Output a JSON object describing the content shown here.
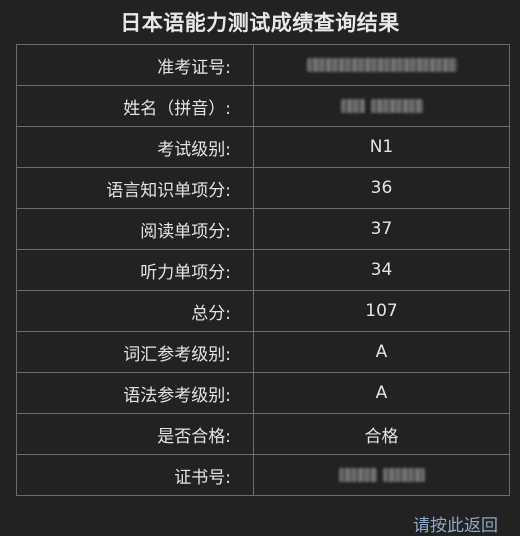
{
  "page": {
    "title": "日本语能力测试成绩查询结果"
  },
  "rows": [
    {
      "label": "准考证号:",
      "value": "",
      "masked": true
    },
    {
      "label": "姓名（拼音）:",
      "value": "",
      "masked": true
    },
    {
      "label": "考试级别:",
      "value": "N1"
    },
    {
      "label": "语言知识单项分:",
      "value": "36"
    },
    {
      "label": "阅读单项分:",
      "value": "37"
    },
    {
      "label": "听力单项分:",
      "value": "34"
    },
    {
      "label": "总分:",
      "value": "107"
    },
    {
      "label": "词汇参考级别:",
      "value": "A"
    },
    {
      "label": "语法参考级别:",
      "value": "A"
    },
    {
      "label": "是否合格:",
      "value": "合格"
    },
    {
      "label": "证书号:",
      "value": "",
      "masked": true
    }
  ],
  "back_link": {
    "label": "请按此返回"
  }
}
